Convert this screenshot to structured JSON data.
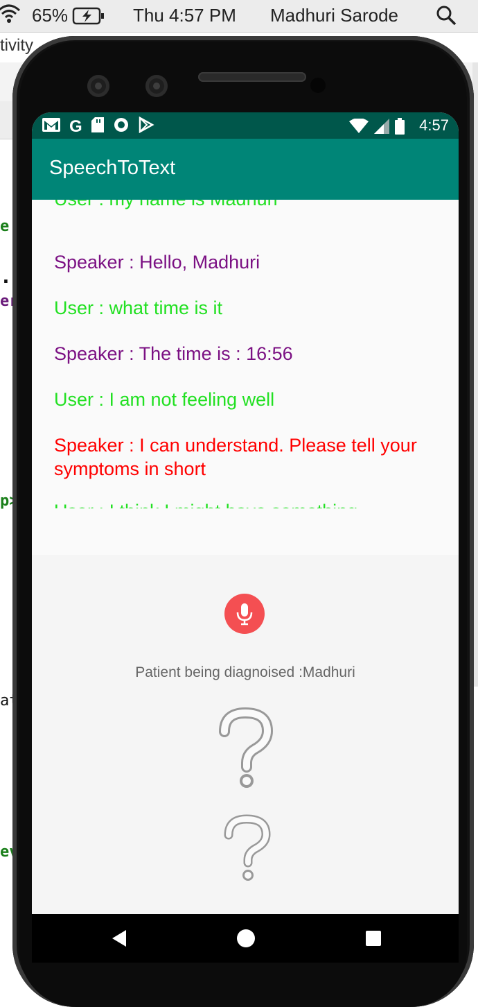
{
  "mac_menu": {
    "battery_percent": "65%",
    "datetime": "Thu 4:57 PM",
    "user": "Madhuri Sarode"
  },
  "ide": {
    "tab_fragment": "tivity",
    "code_fragments": [
      "e",
      ".c",
      "er",
      "p>",
      "at",
      "ev"
    ]
  },
  "status_bar": {
    "time": "4:57",
    "left_icons": [
      "gmail-icon",
      "google-icon",
      "sd-card-icon",
      "circle-icon",
      "play-store-icon"
    ],
    "right_icons": [
      "wifi-icon",
      "signal-icon",
      "battery-icon"
    ]
  },
  "app": {
    "title": "SpeechToText",
    "primary_color": "#008577",
    "status_color": "#00574b"
  },
  "chat": {
    "messages": [
      {
        "text": "User : my name is Madhuri",
        "role": "user"
      },
      {
        "text": "Speaker : Hello, Madhuri",
        "role": "speaker"
      },
      {
        "text": "User : what time is it",
        "role": "user"
      },
      {
        "text": "Speaker : The time is : 16:56",
        "role": "speaker"
      },
      {
        "text": "User : I am not feeling well",
        "role": "user"
      },
      {
        "text": "Speaker : I can understand. Please tell your symptoms in short",
        "role": "speaker-alert"
      },
      {
        "text": "User : I think I might have something",
        "role": "user"
      }
    ],
    "colors": {
      "user": "#22e022",
      "speaker": "#7b1083",
      "speaker-alert": "#ff0000"
    }
  },
  "controls": {
    "mic_icon": "microphone-icon",
    "mic_color": "#f44f52",
    "patient_label": "Patient being diagnoised :Madhuri",
    "images": [
      "question-mark-icon",
      "question-mark-icon"
    ]
  },
  "nav": {
    "icons": [
      "back-icon",
      "home-icon",
      "recents-icon"
    ]
  }
}
